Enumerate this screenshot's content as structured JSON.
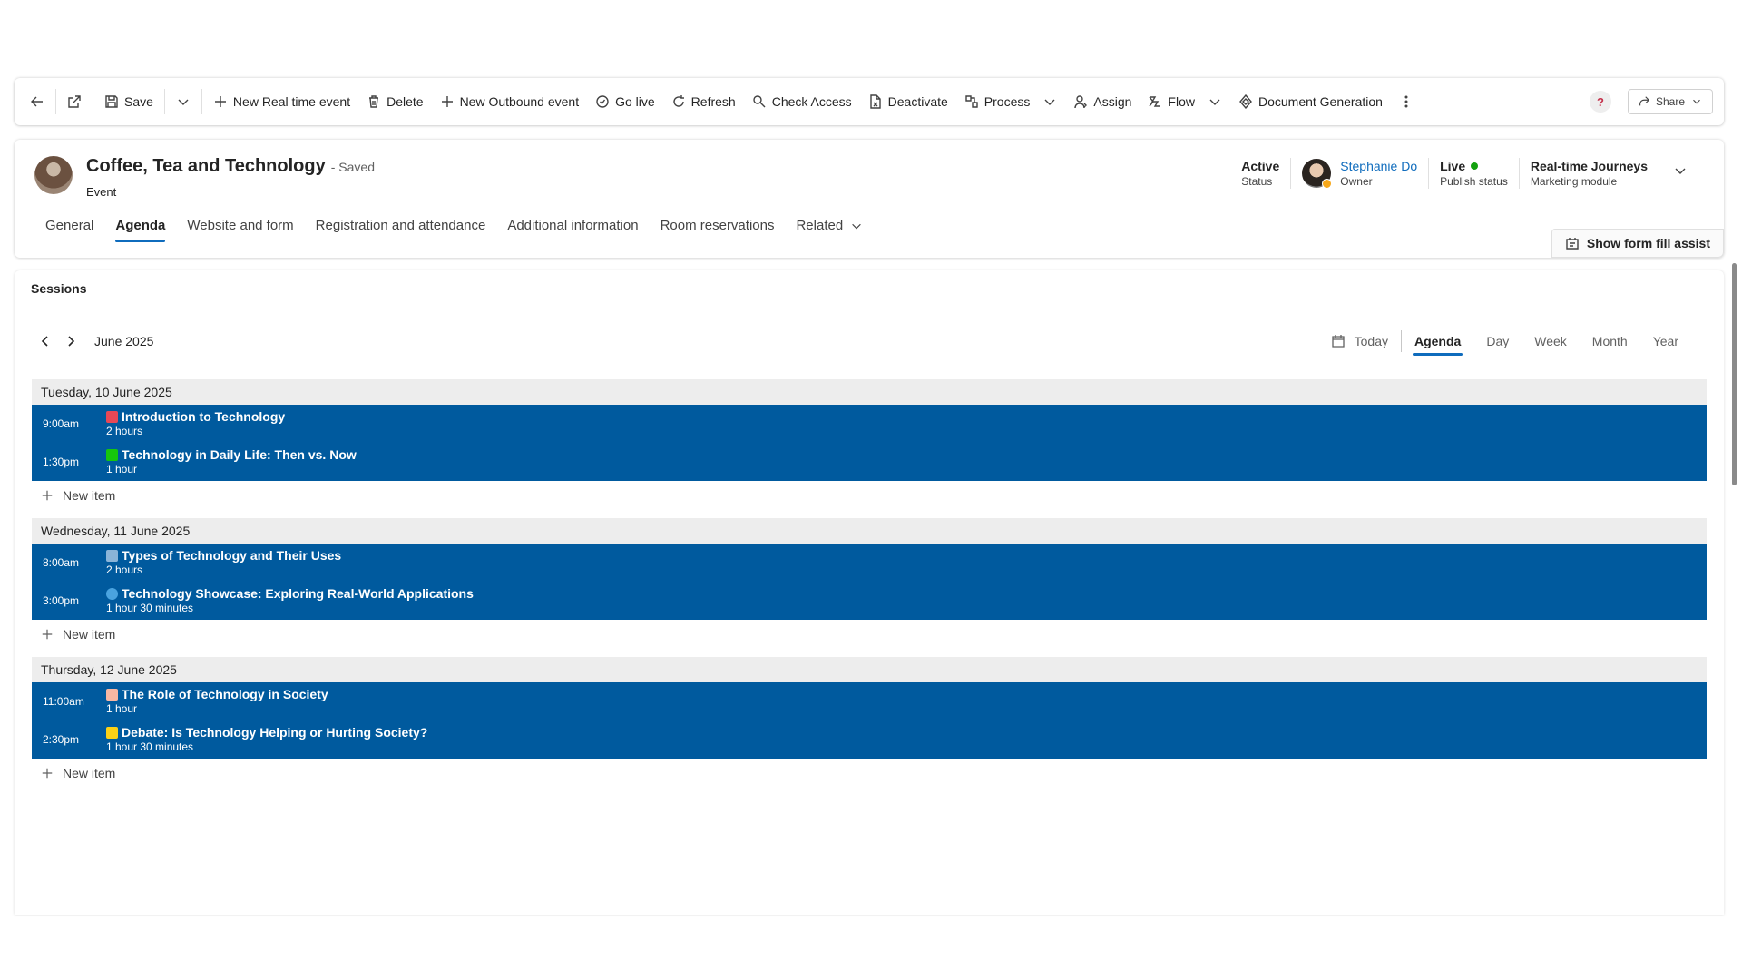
{
  "toolbar": {
    "save": "Save",
    "new_realtime": "New Real time event",
    "delete": "Delete",
    "new_outbound": "New Outbound event",
    "go_live": "Go live",
    "refresh": "Refresh",
    "check_access": "Check Access",
    "deactivate": "Deactivate",
    "process": "Process",
    "assign": "Assign",
    "flow": "Flow",
    "doc_gen": "Document Generation",
    "help": "?",
    "share": "Share"
  },
  "record": {
    "title": "Coffee, Tea and Technology",
    "saved": "- Saved",
    "type": "Event",
    "status_value": "Active",
    "status_label": "Status",
    "owner_name": "Stephanie Do",
    "owner_label": "Owner",
    "publish_value": "Live",
    "publish_label": "Publish status",
    "module_value": "Real-time Journeys",
    "module_label": "Marketing module"
  },
  "tabs": [
    "General",
    "Agenda",
    "Website and form",
    "Registration and attendance",
    "Additional information",
    "Room reservations",
    "Related"
  ],
  "form_fill": "Show form fill assist",
  "sessions": {
    "title": "Sessions",
    "month": "June 2025",
    "views": {
      "today": "Today",
      "agenda": "Agenda",
      "day": "Day",
      "week": "Week",
      "month": "Month",
      "year": "Year"
    },
    "new_item": "New item",
    "days": [
      {
        "date": "Tuesday, 10 June 2025",
        "events": [
          {
            "time": "9:00am",
            "title": "Introduction to Technology",
            "duration": "2 hours",
            "emoji_color": "#e74856"
          },
          {
            "time": "1:30pm",
            "title": "Technology in Daily Life: Then vs. Now",
            "duration": "1 hour",
            "emoji_color": "#16c60c"
          }
        ]
      },
      {
        "date": "Wednesday, 11 June 2025",
        "events": [
          {
            "time": "8:00am",
            "title": "Types of Technology and Their Uses",
            "duration": "2 hours",
            "emoji_color": "#8ab4d8"
          },
          {
            "time": "3:00pm",
            "title": "Technology Showcase: Exploring Real-World Applications",
            "duration": "1 hour 30 minutes",
            "emoji_color": "#4aa3df"
          }
        ]
      },
      {
        "date": "Thursday, 12 June 2025",
        "events": [
          {
            "time": "11:00am",
            "title": "The Role of Technology in Society",
            "duration": "1 hour",
            "emoji_color": "#f7b7a3"
          },
          {
            "time": "2:30pm",
            "title": "Debate: Is Technology Helping or Hurting Society?",
            "duration": "1 hour 30 minutes",
            "emoji_color": "#fcd116"
          }
        ]
      }
    ]
  }
}
